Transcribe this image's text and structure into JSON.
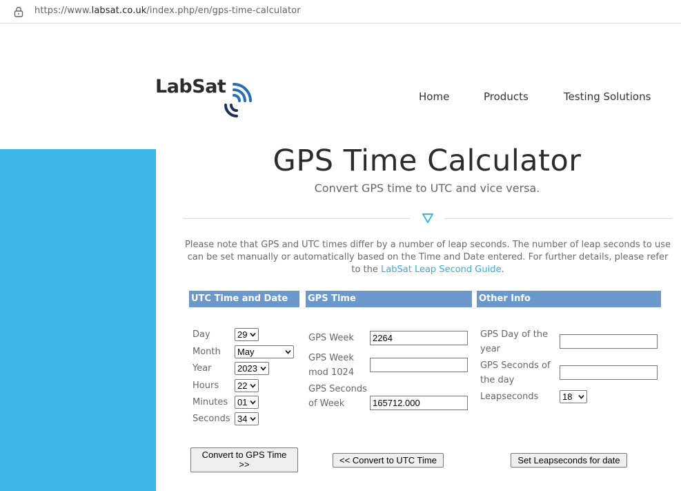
{
  "browser": {
    "url_prefix": "https://www.",
    "url_domain": "labsat.co.uk",
    "url_path": "/index.php/en/gps-time-calculator"
  },
  "header": {
    "logo_text": "LabSat",
    "nav": [
      "Home",
      "Products",
      "Testing Solutions"
    ]
  },
  "colors": {
    "sidebar": "#3cb4e5",
    "column_header": "#6b98cb",
    "link": "#3aa9db"
  },
  "page": {
    "title": "GPS Time Calculator",
    "subtitle": "Convert GPS time to UTC and vice versa.",
    "note_text": "Please note that GPS and UTC times differ by a number of leap seconds. The number of leap seconds to use can be set manually or automatically based on the Time and Date entered. For further details, please refer to the",
    "note_link": "LabSat Leap Second Guide",
    "note_end": "."
  },
  "utc": {
    "heading": "UTC Time and Date",
    "day_label": "Day",
    "day_value": "29",
    "month_label": "Month",
    "month_value": "May",
    "year_label": "Year",
    "year_value": "2023",
    "hours_label": "Hours",
    "hours_value": "22",
    "minutes_label": "Minutes",
    "minutes_value": "01",
    "seconds_label": "Seconds",
    "seconds_value": "34",
    "convert_button": "Convert to GPS Time >>"
  },
  "gps": {
    "heading": "GPS Time",
    "week_label": "GPS Week",
    "week_value": "2264",
    "week_mod_label": "GPS Week mod 1024",
    "week_mod_value": "",
    "seconds_label": "GPS Seconds of Week",
    "seconds_value": "165712.000",
    "convert_button": "<< Convert to UTC Time"
  },
  "other": {
    "heading": "Other Info",
    "day_of_year_label": "GPS Day of the year",
    "day_of_year_value": "",
    "seconds_of_day_label": "GPS Seconds of the day",
    "seconds_of_day_value": "",
    "leapseconds_label": "Leapseconds",
    "leapseconds_value": "18",
    "set_button": "Set Leapseconds for date"
  }
}
